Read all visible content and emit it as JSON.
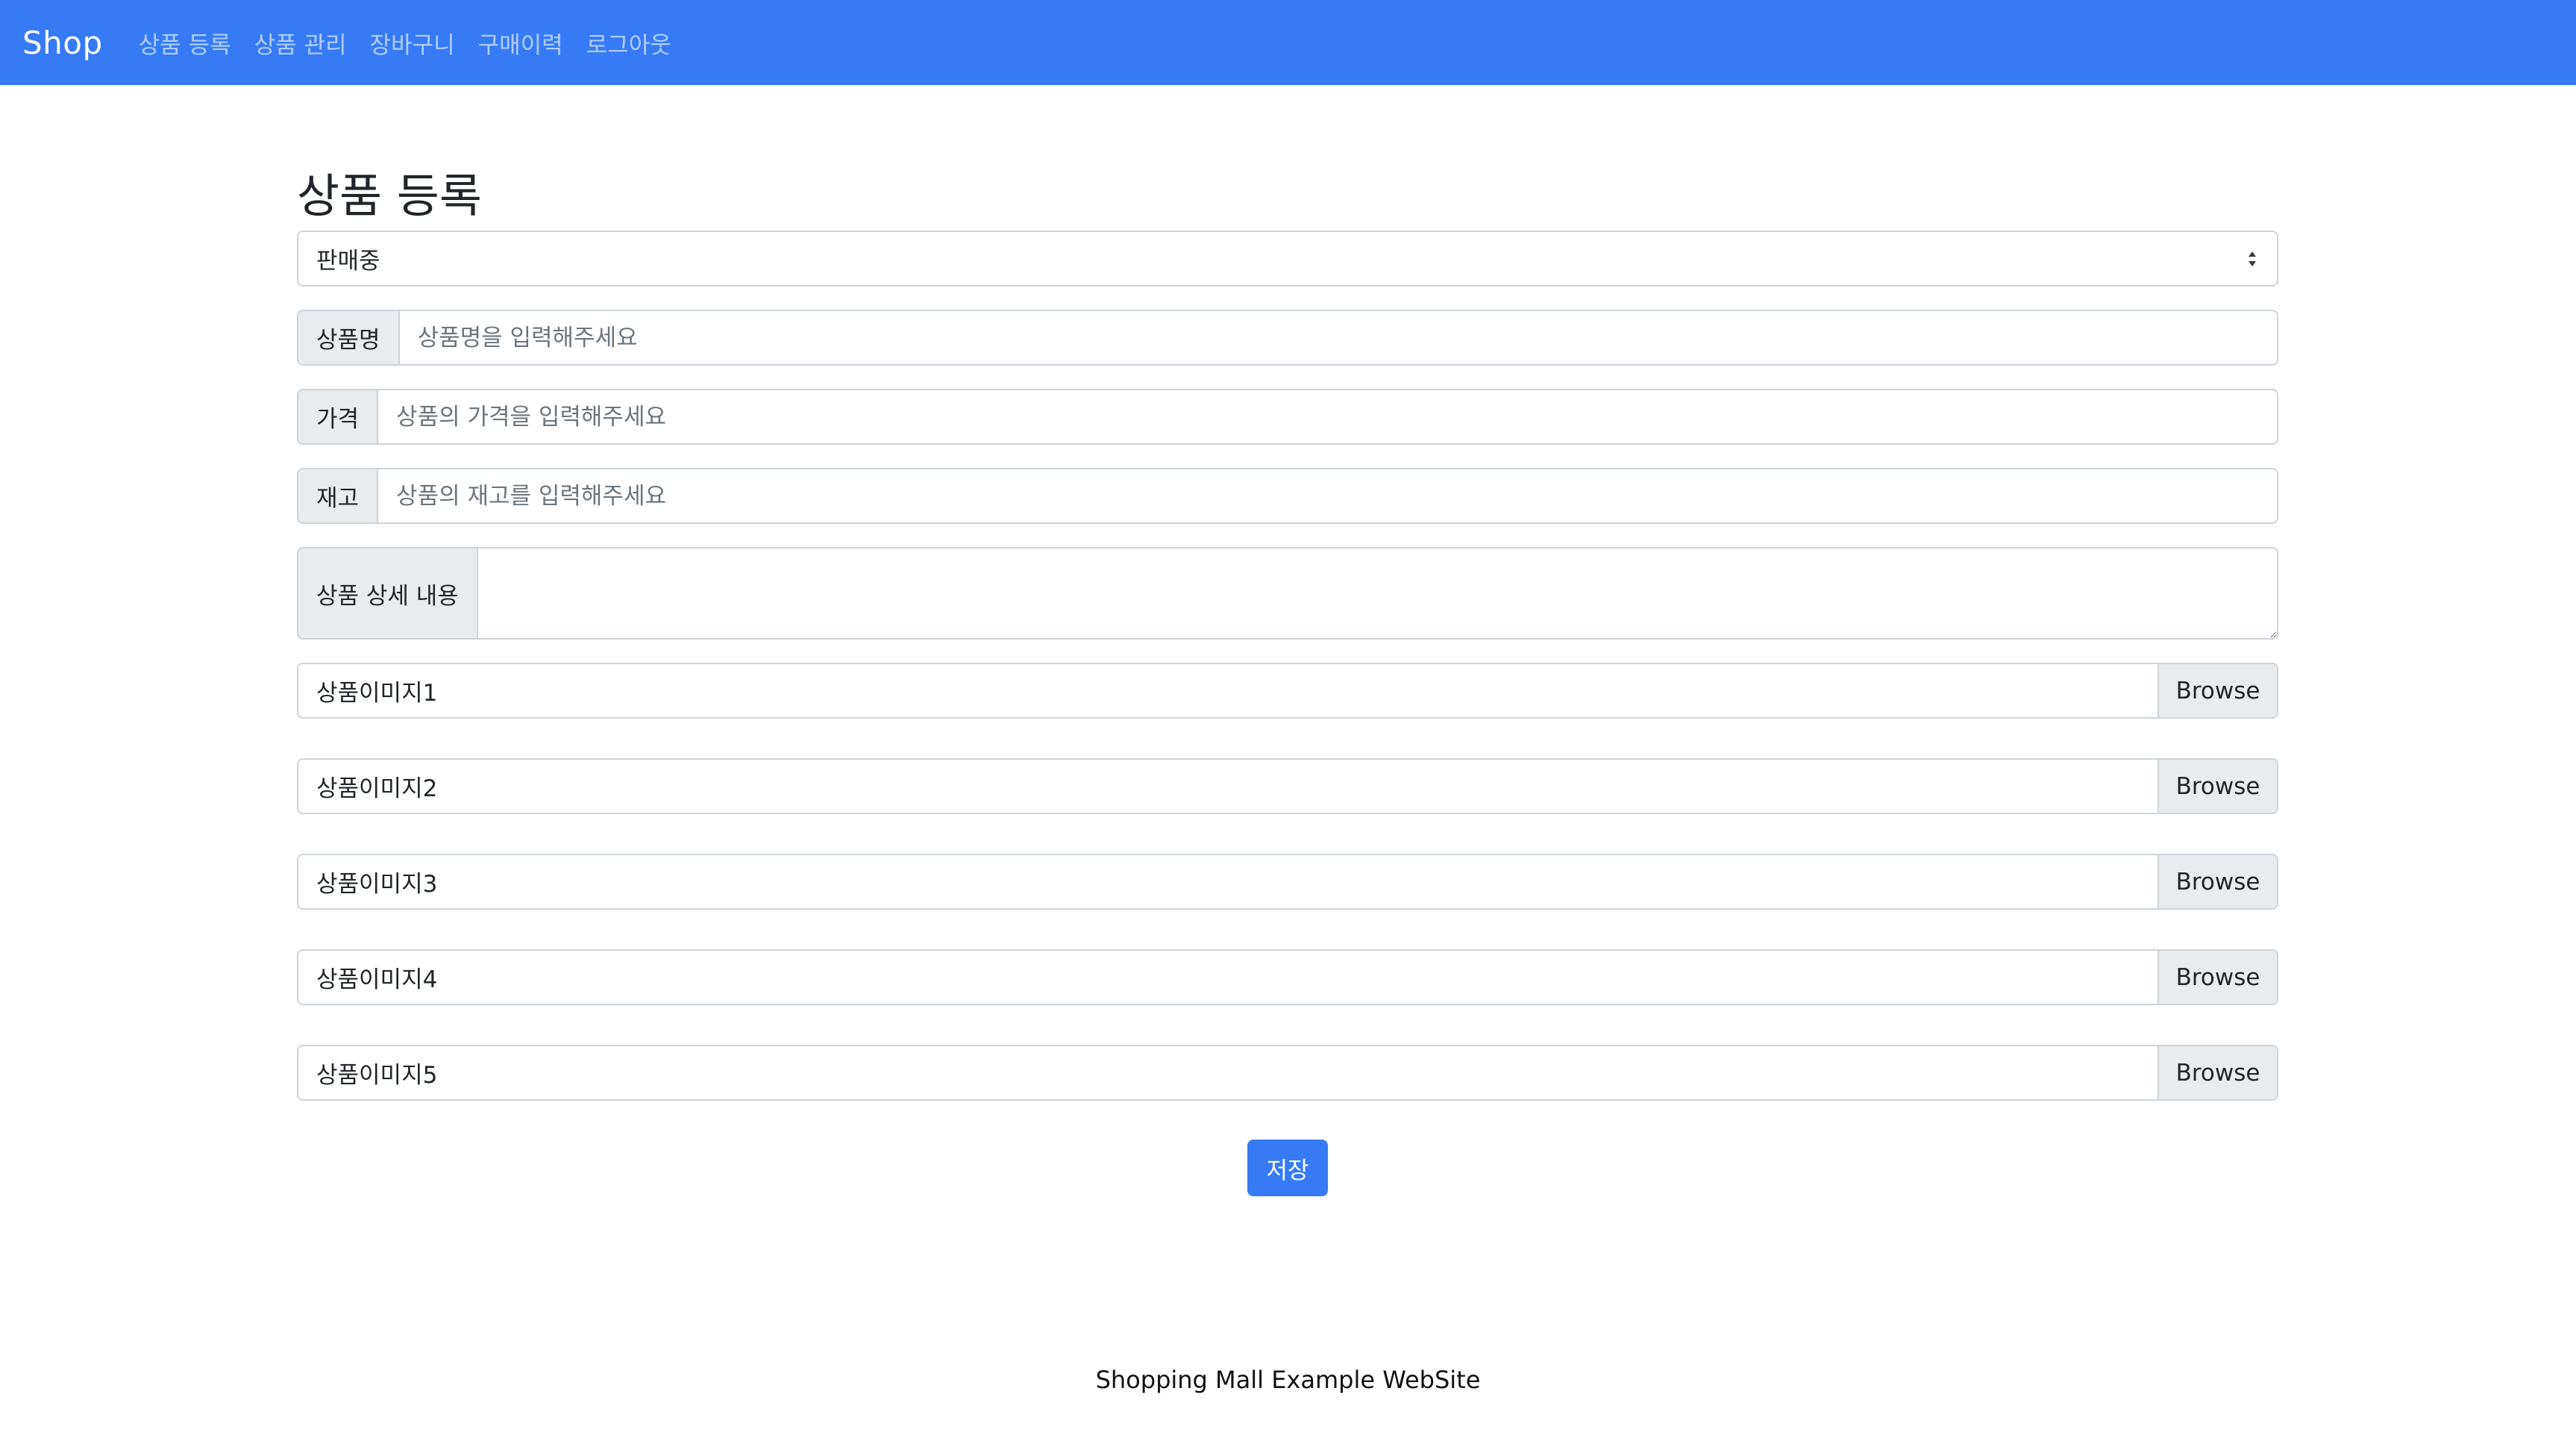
{
  "navbar": {
    "brand": "Shop",
    "links": [
      "상품 등록",
      "상품 관리",
      "장바구니",
      "구매이력",
      "로그아웃"
    ]
  },
  "page": {
    "title": "상품 등록"
  },
  "status_select": {
    "value": "판매중"
  },
  "fields": {
    "name": {
      "label": "상품명",
      "placeholder": "상품명을 입력해주세요"
    },
    "price": {
      "label": "가격",
      "placeholder": "상품의 가격을 입력해주세요"
    },
    "stock": {
      "label": "재고",
      "placeholder": "상품의 재고를 입력해주세요"
    },
    "detail": {
      "label": "상품 상세 내용"
    }
  },
  "images": [
    {
      "label": "상품이미지1",
      "button": "Browse"
    },
    {
      "label": "상품이미지2",
      "button": "Browse"
    },
    {
      "label": "상품이미지3",
      "button": "Browse"
    },
    {
      "label": "상품이미지4",
      "button": "Browse"
    },
    {
      "label": "상품이미지5",
      "button": "Browse"
    }
  ],
  "save_button": "저장",
  "footer": "Shopping Mall Example WebSite",
  "colors": {
    "primary": "#367bf5",
    "addon_bg": "#e9ecef",
    "border": "#ced4da"
  }
}
